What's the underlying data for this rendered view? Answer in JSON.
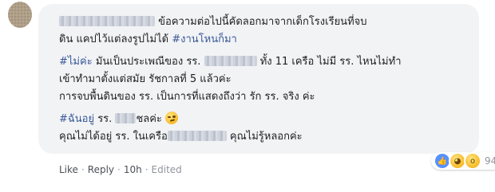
{
  "comment": {
    "lines": [
      {
        "pre": "",
        "post": "ข้อความต่อไปนี้คัดลอกมาจากเด็กโรงเรียนที่จบ"
      },
      {
        "text": "ดิน แคปไว้แต่ลงรูปไม่ได้ ",
        "hashtag": "#งานโหนก็มา"
      },
      {
        "hashtag": "#ไม่ค่ะ",
        "pre": " มันเป็นประเพณีของ รร. ",
        "post": " ทั้ง 11 เครือ ไม่มี รร. ไหนไม่ทำ"
      },
      {
        "text": "เข้าทำมาตั้งแต่สมัย รัชกาลที่ 5 แล้วค่ะ"
      },
      {
        "text": "การจบพื้นดินของ รร. เป็นการที่แสดงถึงว่า รัก รร. จริง ค่ะ"
      },
      {
        "hashtag": "#ฉันอยู่",
        "pre": " รร. ",
        "post": "ชลค่ะ"
      },
      {
        "pre": "คุณไม่ได้อยู่ รร. ในเครือ",
        "post": " คุณไม่รู้หลอกค่ะ"
      }
    ]
  },
  "actions": {
    "like": "Like",
    "reply": "Reply",
    "time": "10h",
    "edited": "Edited",
    "separator": "·"
  },
  "reactions": {
    "icons": [
      "like",
      "haha",
      "wow"
    ],
    "count": "94",
    "colors": {
      "like": "#5890ff",
      "emoji": "#f7b928"
    }
  },
  "colors": {
    "bubble": "#f2f3f5",
    "link": "#385898",
    "meta": "#90949c"
  }
}
